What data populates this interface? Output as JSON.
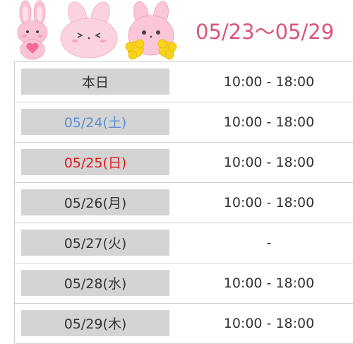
{
  "title": "05/23～05/29",
  "colors": {
    "title": "#d9567a",
    "saturday": "#5b8fd4",
    "sunday": "#e01818",
    "weekday": "#333333",
    "day_bg": "#d4d4d4"
  },
  "icons": [
    "bunny-heart-icon",
    "bunny-squint-icon",
    "bunny-pompom-icon"
  ],
  "schedule": [
    {
      "day": "本日",
      "hours": "10:00 - 18:00",
      "color": "#333333"
    },
    {
      "day": "05/24(土)",
      "hours": "10:00 - 18:00",
      "color": "#5b8fd4"
    },
    {
      "day": "05/25(日)",
      "hours": "10:00 - 18:00",
      "color": "#e01818"
    },
    {
      "day": "05/26(月)",
      "hours": "10:00 - 18:00",
      "color": "#333333"
    },
    {
      "day": "05/27(火)",
      "hours": "-",
      "color": "#333333"
    },
    {
      "day": "05/28(水)",
      "hours": "10:00 - 18:00",
      "color": "#333333"
    },
    {
      "day": "05/29(木)",
      "hours": "10:00 - 18:00",
      "color": "#333333"
    }
  ]
}
